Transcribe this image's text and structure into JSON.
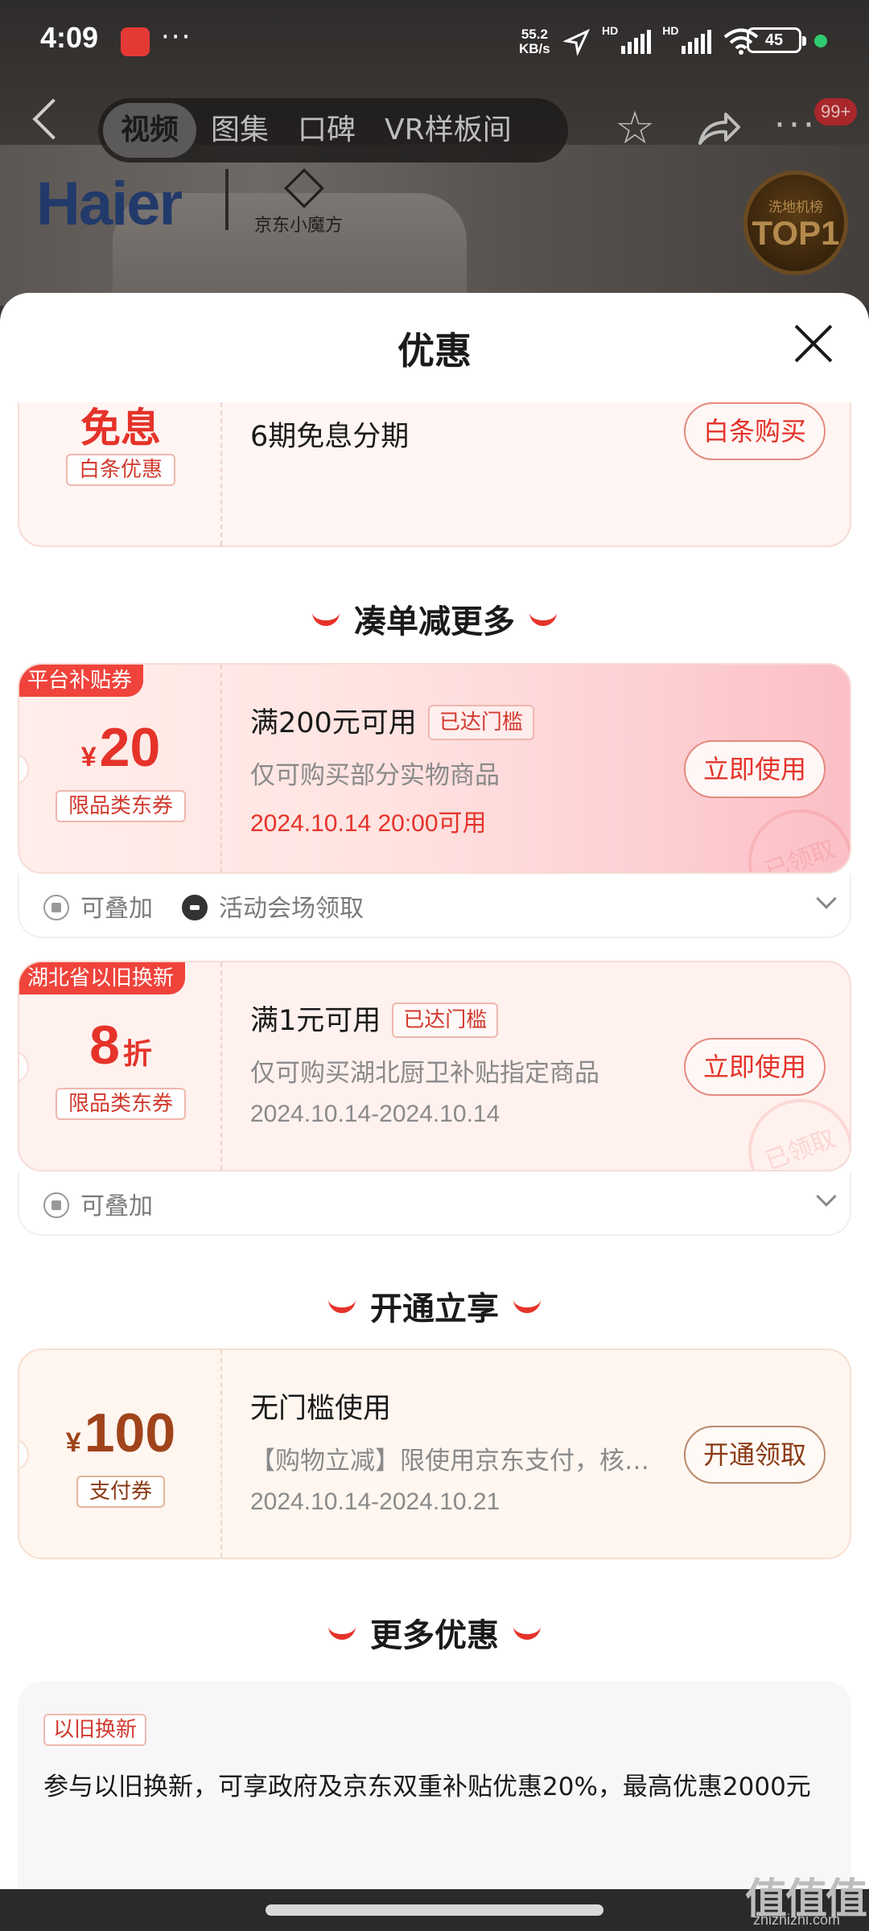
{
  "status_bar": {
    "time": "4:09",
    "dots": "···",
    "speed_value": "55.2",
    "speed_unit": "KB/s",
    "hd_1": "HD",
    "hd_2": "HD",
    "battery": "45"
  },
  "nav": {
    "tabs": [
      {
        "label": "视频",
        "active": true
      },
      {
        "label": "图集",
        "active": false
      },
      {
        "label": "口碑",
        "active": false
      },
      {
        "label": "VR样板间",
        "active": false
      }
    ],
    "badge": "99+"
  },
  "product": {
    "brand": "Haier",
    "partner": "京东小魔方",
    "badge_line1": "洗地机榜",
    "badge_line2": "TOP1"
  },
  "sheet": {
    "title": "优惠"
  },
  "baitiao_coupon": {
    "big_text": "免息",
    "tag": "白条优惠",
    "title": "6期免息分期",
    "button": "白条购买"
  },
  "section_1": {
    "title": "凑单减更多"
  },
  "coupon_platform": {
    "corner_tag": "平台补贴券",
    "currency": "¥",
    "amount": "20",
    "tag": "限品类东券",
    "title": "满200元可用",
    "reached": "已达门槛",
    "desc": "仅可购买部分实物商品",
    "date": "2024.10.14 20:00可用",
    "button": "立即使用",
    "stamp": "已领取",
    "foot_stack": "可叠加",
    "foot_source": "活动会场领取"
  },
  "coupon_hubei": {
    "corner_tag": "湖北省以旧换新",
    "amount": "8",
    "unit": "折",
    "tag": "限品类东券",
    "title": "满1元可用",
    "reached": "已达门槛",
    "desc": "仅可购买湖北厨卫补贴指定商品",
    "date": "2024.10.14-2024.10.14",
    "button": "立即使用",
    "stamp": "已领取",
    "foot_stack": "可叠加"
  },
  "section_2": {
    "title": "开通立享"
  },
  "coupon_pay": {
    "currency": "¥",
    "amount": "100",
    "tag": "支付券",
    "title": "无门槛使用",
    "desc": "【购物立减】限使用京东支付，核…",
    "date": "2024.10.14-2024.10.21",
    "button": "开通领取"
  },
  "section_3": {
    "title": "更多优惠"
  },
  "more_offer": {
    "tag": "以旧换新",
    "text": "参与以旧换新，可享政府及京东双重补贴优惠20%，最高优惠2000元"
  },
  "watermark": {
    "logo": "值值值",
    "url": "zhizhizhi.com"
  },
  "colors": {
    "accent": "#e5332a",
    "sheet_bg": "#ffffff",
    "coupon_bg": "#fff5f2",
    "corner_tag": "#f0433b"
  }
}
